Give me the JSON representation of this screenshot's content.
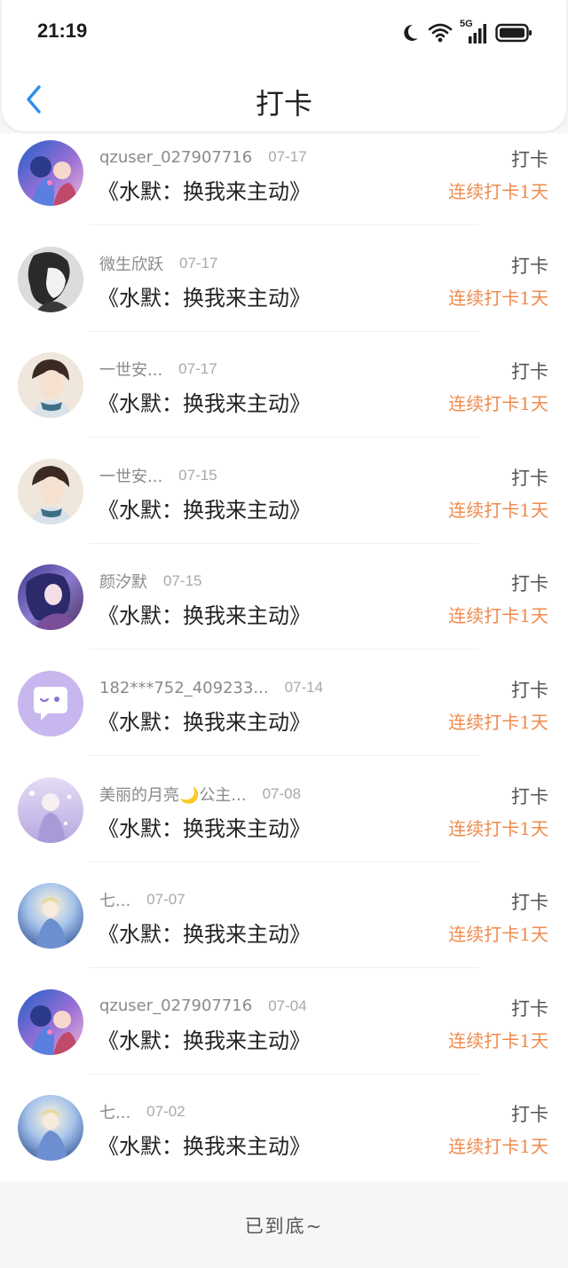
{
  "status_bar": {
    "time": "21:19",
    "network": "5G"
  },
  "nav": {
    "title": "打卡"
  },
  "rows": [
    {
      "username": "qzuser_027907716",
      "date": "07-17",
      "book": "《水默：换我来主动》",
      "action": "打卡",
      "streak": "连续打卡1天",
      "avatar": "avatar-a"
    },
    {
      "username": "微生欣跃",
      "date": "07-17",
      "book": "《水默：换我来主动》",
      "action": "打卡",
      "streak": "连续打卡1天",
      "avatar": "avatar-b"
    },
    {
      "username": "一世安...",
      "date": "07-17",
      "book": "《水默：换我来主动》",
      "action": "打卡",
      "streak": "连续打卡1天",
      "avatar": "avatar-c"
    },
    {
      "username": "一世安...",
      "date": "07-15",
      "book": "《水默：换我来主动》",
      "action": "打卡",
      "streak": "连续打卡1天",
      "avatar": "avatar-c"
    },
    {
      "username": "颜汐默",
      "date": "07-15",
      "book": "《水默：换我来主动》",
      "action": "打卡",
      "streak": "连续打卡1天",
      "avatar": "avatar-d"
    },
    {
      "username": "182***752_409233...",
      "date": "07-14",
      "book": "《水默：换我来主动》",
      "action": "打卡",
      "streak": "连续打卡1天",
      "avatar": "avatar-e"
    },
    {
      "username": "美丽的月亮🌙公主...",
      "date": "07-08",
      "book": "《水默：换我来主动》",
      "action": "打卡",
      "streak": "连续打卡1天",
      "avatar": "avatar-f"
    },
    {
      "username": "七...",
      "date": "07-07",
      "book": "《水默：换我来主动》",
      "action": "打卡",
      "streak": "连续打卡1天",
      "avatar": "avatar-g"
    },
    {
      "username": "qzuser_027907716",
      "date": "07-04",
      "book": "《水默：换我来主动》",
      "action": "打卡",
      "streak": "连续打卡1天",
      "avatar": "avatar-a"
    },
    {
      "username": "七...",
      "date": "07-02",
      "book": "《水默：换我来主动》",
      "action": "打卡",
      "streak": "连续打卡1天",
      "avatar": "avatar-g"
    }
  ],
  "footer": {
    "text": "已到底~"
  },
  "colors": {
    "accent_blue": "#2d8ee8",
    "streak_orange": "#f08a4b"
  }
}
